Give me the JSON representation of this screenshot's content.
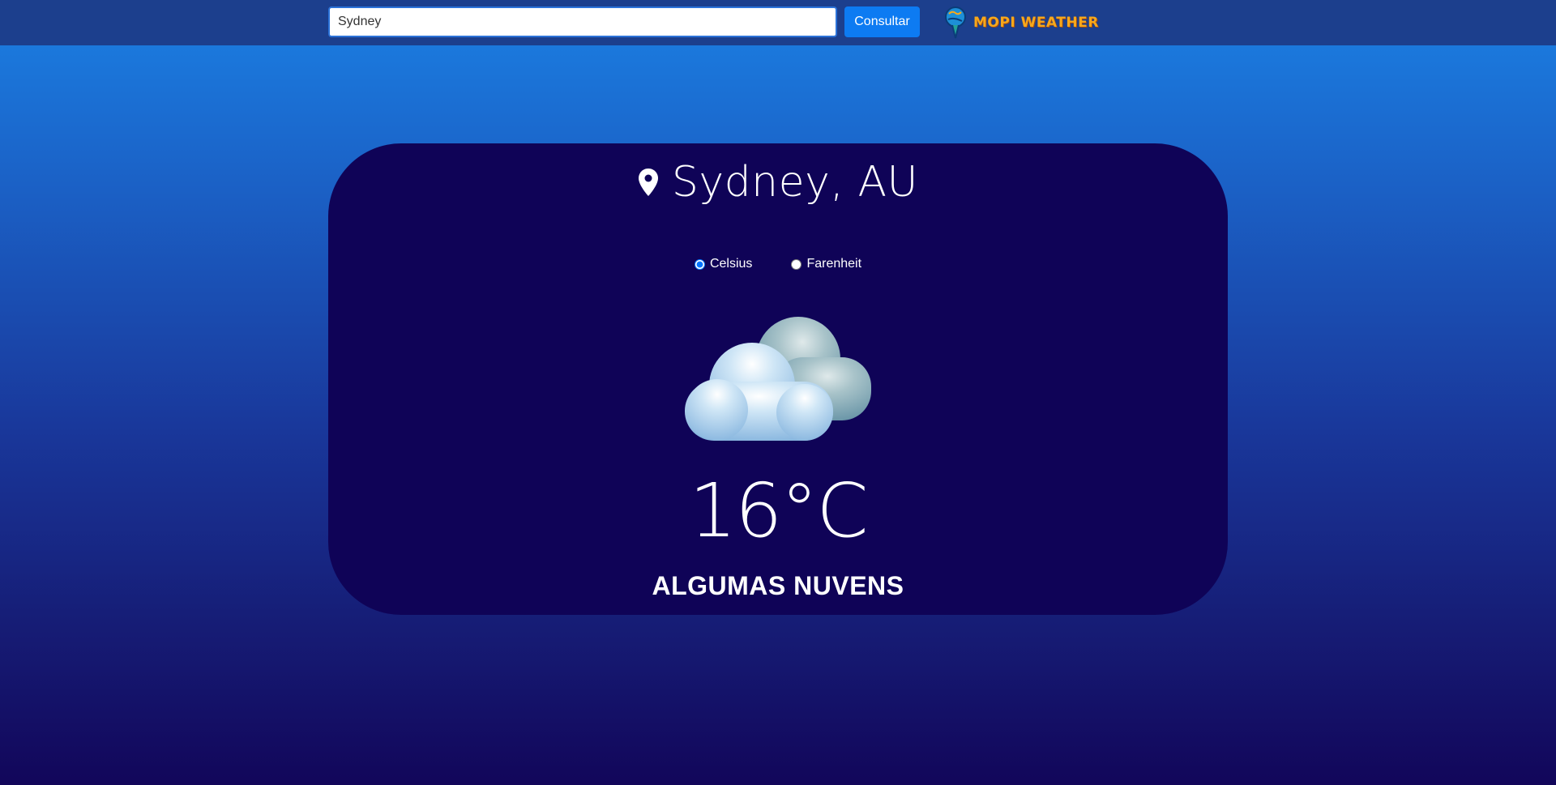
{
  "header": {
    "search": {
      "value": "Sydney",
      "placeholder": ""
    },
    "consult_label": "Consultar",
    "logo_text": "MOPI WEATHER"
  },
  "weather": {
    "location": "Sydney, AU",
    "units": [
      {
        "label": "Celsius",
        "selected": true
      },
      {
        "label": "Farenheit",
        "selected": false
      }
    ],
    "icon": "partly-cloudy-icon",
    "temperature": "16°C",
    "description": "ALGUMAS NUVENS"
  },
  "colors": {
    "topbar": "#1c3f8d",
    "card": "#0f0357",
    "button": "#0d7bf2",
    "logo": "#f7a81b"
  }
}
